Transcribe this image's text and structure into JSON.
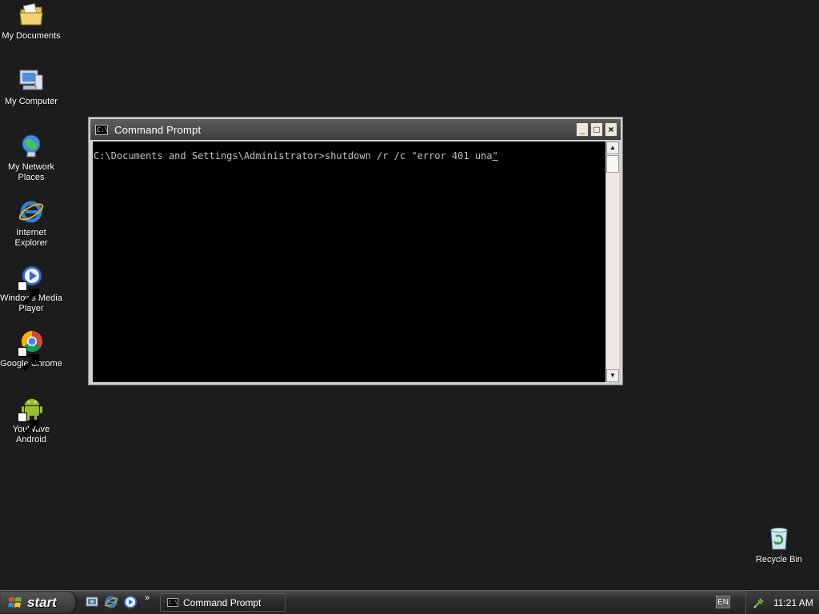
{
  "desktop": {
    "icons": [
      {
        "label_line1": "My Documents",
        "label_line2": "",
        "icon": "my-documents-icon"
      },
      {
        "label_line1": "My Computer",
        "label_line2": "",
        "icon": "my-computer-icon"
      },
      {
        "label_line1": "My Network",
        "label_line2": "Places",
        "icon": "network-places-icon"
      },
      {
        "label_line1": "Internet",
        "label_line2": "Explorer",
        "icon": "internet-explorer-icon"
      },
      {
        "label_line1": "Windows Media",
        "label_line2": "Player",
        "icon": "windows-media-player-icon"
      },
      {
        "label_line1": "Google Chrome",
        "label_line2": "",
        "icon": "google-chrome-icon"
      },
      {
        "label_line1": "YouWave",
        "label_line2": "Android",
        "icon": "android-icon"
      },
      {
        "label_line1": "Recycle Bin",
        "label_line2": "",
        "icon": "recycle-bin-icon"
      }
    ]
  },
  "window": {
    "title": "Command Prompt",
    "icon_glyph": "C:\\",
    "buttons": {
      "minimize": "_",
      "maximize": "□",
      "close": "×"
    },
    "console": {
      "prompt": "C:\\Documents and Settings\\Administrator>",
      "command": "shutdown /r /c \"error 401 una",
      "cursor_char": "\""
    },
    "scrollbar": {
      "up": "▲",
      "down": "▼"
    }
  },
  "taskbar": {
    "start_label": "start",
    "quick_launch": [
      "show-desktop-icon",
      "internet-explorer-icon",
      "windows-media-player-icon"
    ],
    "chevron": "»",
    "task_item_label": "Command Prompt",
    "language": "EN",
    "clock": "11:21 AM"
  },
  "colors": {
    "desktop_bg": "#1c1c1c",
    "console_bg": "#000000",
    "console_text": "#c0c0c0",
    "titlebar": "#4a4a4a"
  }
}
